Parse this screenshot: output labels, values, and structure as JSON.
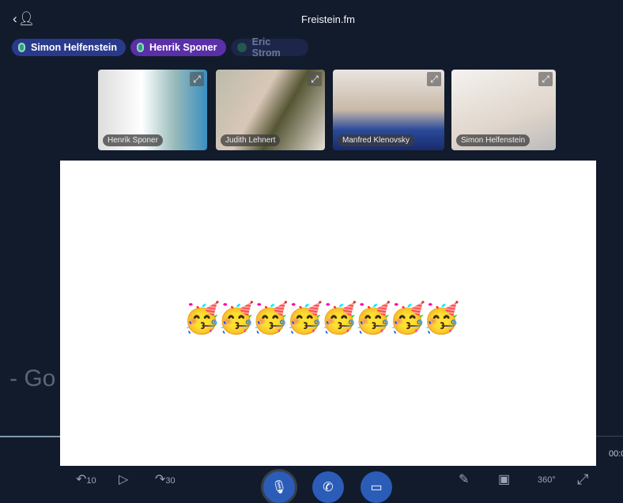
{
  "header": {
    "title": "Freistein.fm",
    "back_icon": "back-user-icon"
  },
  "speakers": [
    {
      "name": "Simon Helfenstein",
      "state": "speaking",
      "color": "#2a3a8a"
    },
    {
      "name": "Henrik Sponer",
      "state": "speaking",
      "color": "#5a2fa8"
    },
    {
      "name": "Eric Strom",
      "state": "muted",
      "color": "#1d2548"
    }
  ],
  "videos": [
    {
      "name": "Henrik Sponer"
    },
    {
      "name": "Judith Lehnert"
    },
    {
      "name": "Manfred Klenovsky"
    },
    {
      "name": "Simon Helfenstein"
    }
  ],
  "background_text": "- Go",
  "shared_content": {
    "emojis": "🥳🥳🥳🥳🥳🥳🥳🥳"
  },
  "player": {
    "time": "00:0",
    "rewind": "10",
    "forward": "30",
    "view360": "360°"
  }
}
